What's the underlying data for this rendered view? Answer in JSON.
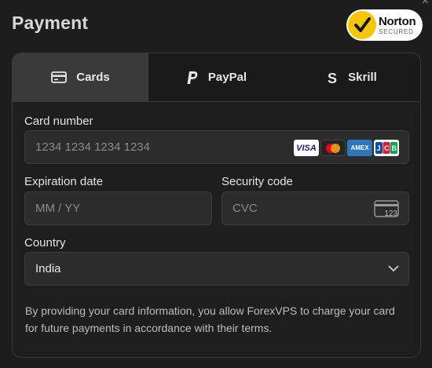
{
  "window": {
    "close_symbol": "×"
  },
  "header": {
    "title": "Payment",
    "badge": {
      "brand": "Norton",
      "sub": "SECURED",
      "icon": "checkmark-icon"
    }
  },
  "tabs": [
    {
      "label": "Cards",
      "icon": "card-icon",
      "active": true
    },
    {
      "label": "PayPal",
      "icon": "paypal-icon",
      "active": false
    },
    {
      "label": "Skrill",
      "icon": "skrill-icon",
      "active": false
    }
  ],
  "form": {
    "card_number": {
      "label": "Card number",
      "placeholder": "1234 1234 1234 1234",
      "value": "",
      "brands": [
        "VISA",
        "Mastercard",
        "AMEX",
        "JCB"
      ]
    },
    "expiration": {
      "label": "Expiration date",
      "placeholder": "MM / YY",
      "value": ""
    },
    "security_code": {
      "label": "Security code",
      "placeholder": "CVC",
      "value": "",
      "icon_text": "123"
    },
    "country": {
      "label": "Country",
      "selected": "India"
    },
    "note": "By providing your card information, you allow ForexVPS to charge your card for future payments in accordance with their terms."
  },
  "colors": {
    "background": "#1d1d1d",
    "active_tab": "#3a3a3a",
    "input_bg": "#2c2c2c",
    "norton_yellow": "#f7c600"
  }
}
